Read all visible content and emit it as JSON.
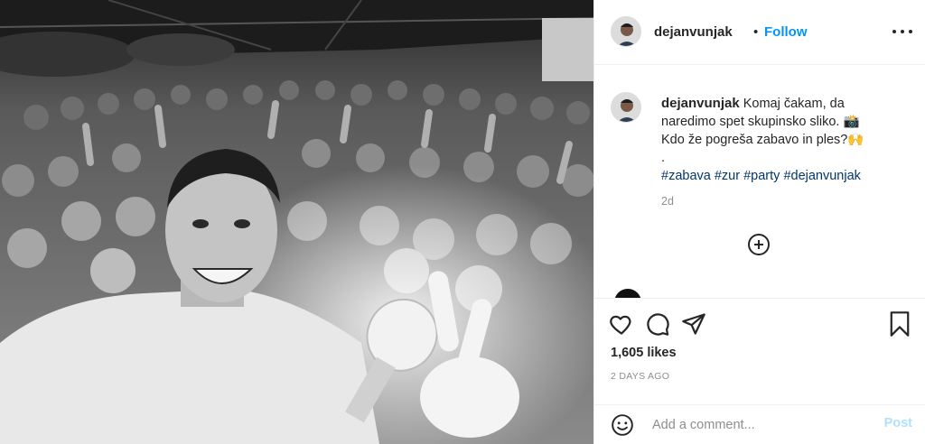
{
  "post": {
    "username": "dejanvunjak",
    "separator": "•",
    "follow_label": "Follow",
    "more_icon": "more-options-icon",
    "caption": {
      "line1": "Komaj čakam, da naredimo spet skupinsko sliko. 📸",
      "line2": "Kdo že pogreša zabavo in ples?🙌",
      "line3": ".",
      "hashtags": [
        "#zabava",
        "#zur",
        "#party",
        "#dejanvunjak"
      ],
      "time": "2d"
    },
    "load_more_icon": "plus-circle-icon",
    "likes": "1,605 likes",
    "time_ago": "2 DAYS AGO",
    "comment_placeholder": "Add a comment...",
    "post_label": "Post"
  },
  "colors": {
    "link_blue": "#0095f6",
    "hashtag_blue": "#00376b",
    "muted_gray": "#8e8e8e",
    "post_disabled": "#b2dffc",
    "border": "#efefef"
  }
}
